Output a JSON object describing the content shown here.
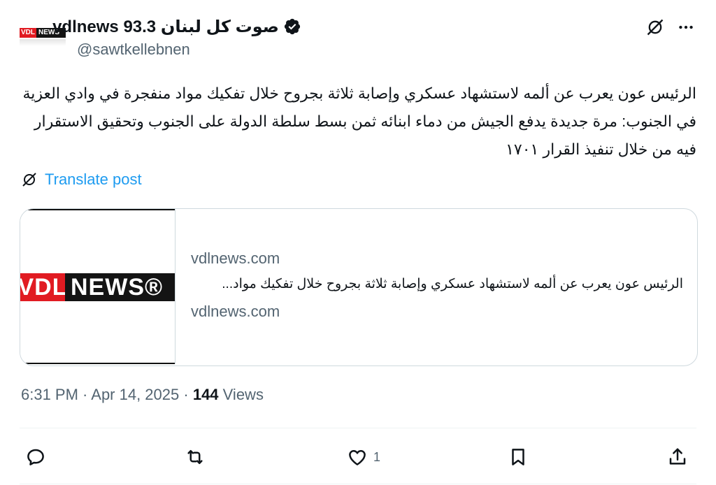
{
  "account": {
    "display_name": "vdlnews 93.3 صوت كل لبنان",
    "handle": "@sawtkellebnen",
    "avatar": {
      "vl": "VDL",
      "news": "NEWS"
    }
  },
  "post": {
    "text": "الرئيس عون يعرب عن ألمه لاستشهاد عسكري وإصابة ثلاثة بجروح خلال تفكيك مواد منفجرة في وادي العزية في الجنوب: مرة جديدة يدفع الجيش من دماء ابنائه ثمن بسط سلطة الدولة على الجنوب وتحقيق الاستقرار فيه من خلال تنفيذ القرار ١٧٠١",
    "translate_label": "Translate post"
  },
  "card": {
    "logo_vl": "VDL",
    "logo_news": "NEWS®",
    "domain_top": "vdlnews.com",
    "title": "الرئيس عون يعرب عن ألمه لاستشهاد عسكري وإصابة ثلاثة بجروح خلال تفكيك مواد...",
    "domain_bottom": "vdlnews.com"
  },
  "meta": {
    "timestamp": "6:31 PM · Apr 14, 2025",
    "separator": " · ",
    "views_count": "144",
    "views_label": " Views"
  },
  "actions": {
    "reply_count": "",
    "repost_count": "",
    "like_count": "1",
    "bookmark_count": ""
  },
  "colors": {
    "text": "#0f1419",
    "secondary": "#536471",
    "link": "#1d9bf0",
    "border": "#cfd9de",
    "brand_red": "#e11b22"
  },
  "icons": [
    "verified-badge-icon",
    "grok-icon",
    "more-icon",
    "translate-icon",
    "reply-icon",
    "repost-icon",
    "like-icon",
    "bookmark-icon",
    "share-icon"
  ]
}
